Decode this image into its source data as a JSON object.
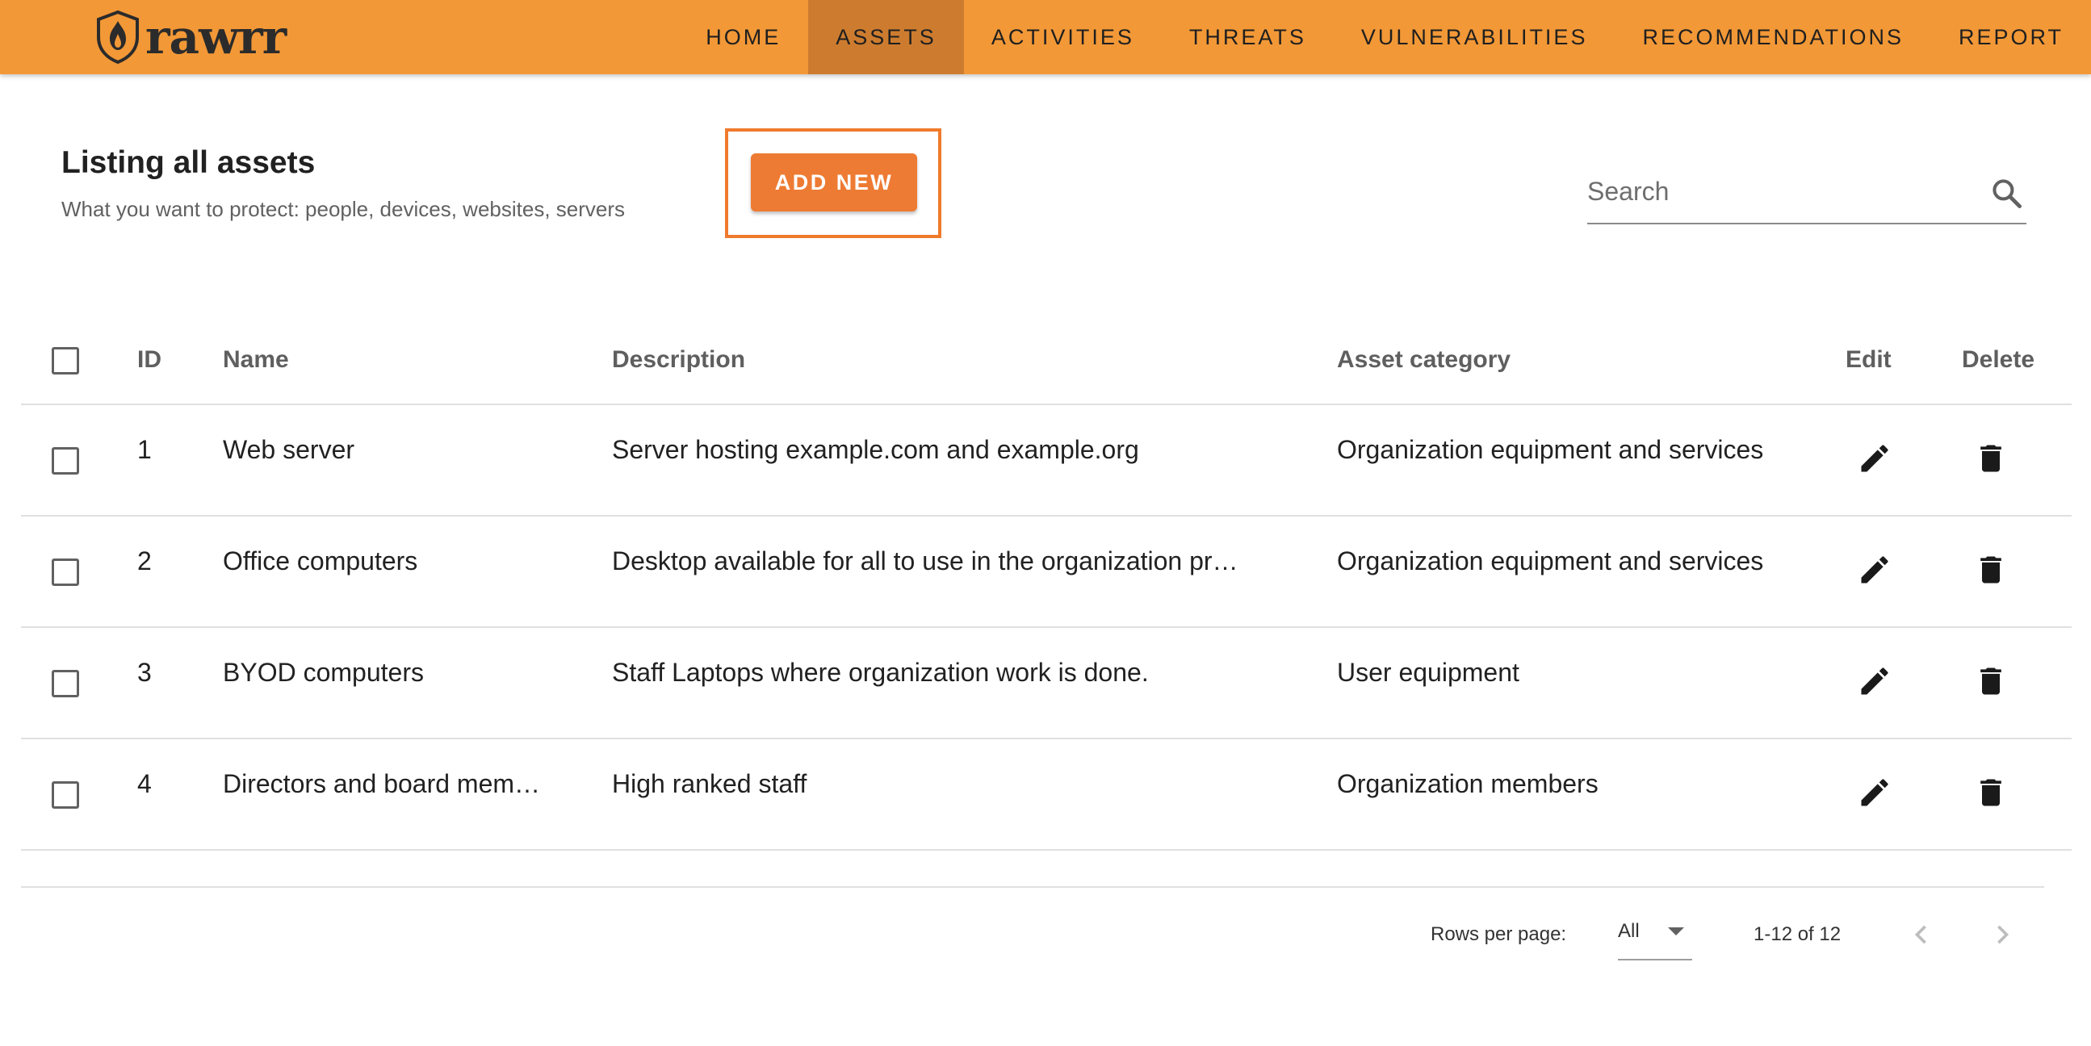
{
  "header": {
    "logo_text": "rawrr",
    "nav": [
      {
        "label": "HOME",
        "active": false
      },
      {
        "label": "ASSETS",
        "active": true
      },
      {
        "label": "ACTIVITIES",
        "active": false
      },
      {
        "label": "THREATS",
        "active": false
      },
      {
        "label": "VULNERABILITIES",
        "active": false
      },
      {
        "label": "RECOMMENDATIONS",
        "active": false
      },
      {
        "label": "REPORT",
        "active": false
      }
    ]
  },
  "main": {
    "title": "Listing all assets",
    "subtitle": "What you want to protect: people, devices, websites, servers",
    "add_button": "ADD NEW",
    "search_placeholder": "Search"
  },
  "table": {
    "columns": {
      "id": "ID",
      "name": "Name",
      "description": "Description",
      "category": "Asset category",
      "edit": "Edit",
      "delete": "Delete"
    },
    "rows": [
      {
        "id": "1",
        "name": "Web server",
        "description": "Server hosting example.com and example.org",
        "category": "Organization equipment and services"
      },
      {
        "id": "2",
        "name": "Office computers",
        "description": "Desktop available for all to use in the organization pr…",
        "category": "Organization equipment and services"
      },
      {
        "id": "3",
        "name": "BYOD computers",
        "description": "Staff Laptops where organization work is done.",
        "category": "User equipment"
      },
      {
        "id": "4",
        "name": "Directors and board mem…",
        "description": "High ranked staff",
        "category": "Organization members"
      }
    ]
  },
  "pagination": {
    "rows_per_page_label": "Rows per page:",
    "rows_per_page_value": "All",
    "range": "1-12 of 12"
  },
  "colors": {
    "header_bg": "#f29837",
    "nav_active_bg": "#cd7c2f",
    "accent_button": "#ee7b33"
  }
}
